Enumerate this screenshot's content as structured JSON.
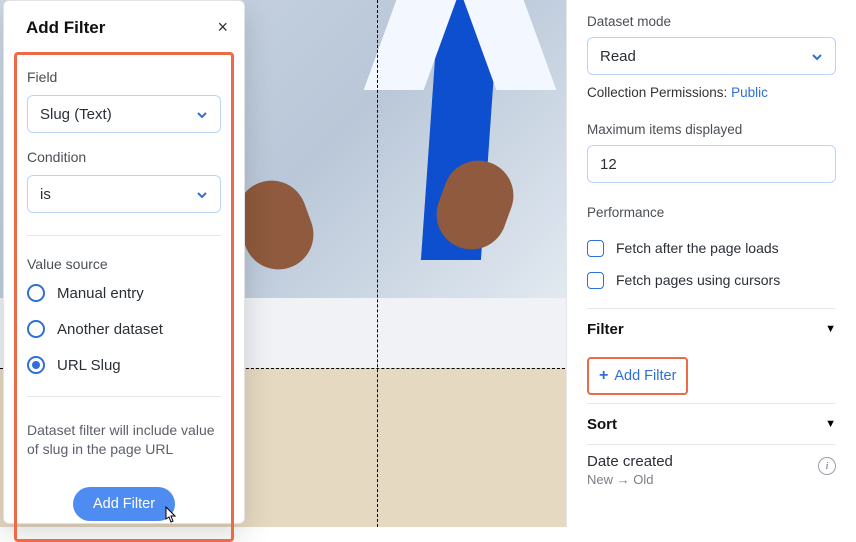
{
  "modal": {
    "title": "Add Filter",
    "close_icon": "×",
    "field_label": "Field",
    "field_value": "Slug (Text)",
    "condition_label": "Condition",
    "condition_value": "is",
    "value_source_label": "Value source",
    "options": {
      "manual": "Manual entry",
      "another": "Another dataset",
      "url_slug": "URL Slug"
    },
    "help_text": "Dataset filter will include value of slug in the page URL",
    "submit_label": "Add Filter"
  },
  "panel": {
    "dataset_mode_label": "Dataset mode",
    "dataset_mode_value": "Read",
    "permissions_label": "Collection Permissions:",
    "permissions_value": "Public",
    "max_items_label": "Maximum items displayed",
    "max_items_value": "12",
    "performance_label": "Performance",
    "checks": {
      "after_load": "Fetch after the page loads",
      "cursors": "Fetch pages using cursors"
    },
    "filter_heading": "Filter",
    "add_filter_label": "Add Filter",
    "sort_heading": "Sort",
    "sort_main": "Date created",
    "sort_sub": "New → Old"
  }
}
